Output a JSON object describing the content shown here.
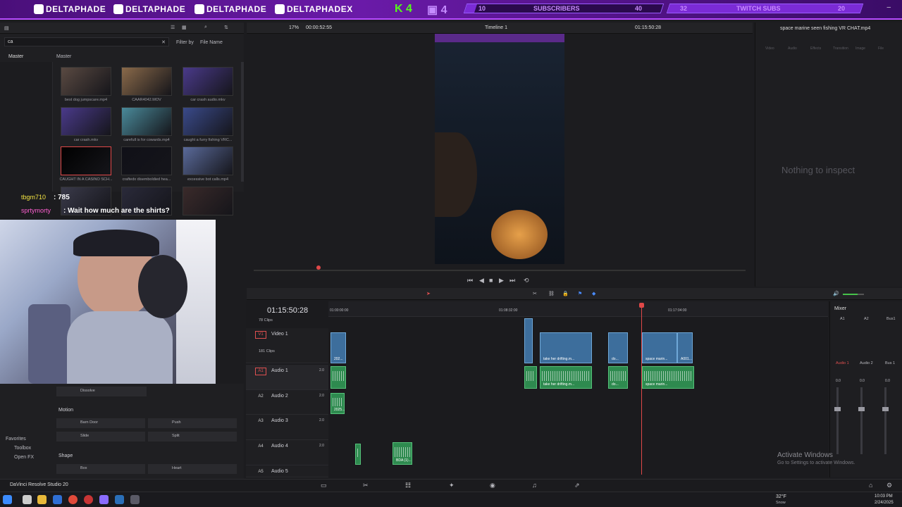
{
  "banner": {
    "socials": [
      "DELTAPHADE",
      "DELTAPHADE",
      "DELTAPHADE",
      "DELTAPHADEX"
    ],
    "kick_label": "K 4",
    "twitch_count": "4",
    "goals": [
      {
        "start": "10",
        "label": "SUBSCRIBERS",
        "end": "40",
        "progress": 0.05
      },
      {
        "start": "32",
        "label": "TWITCH SUBS",
        "end": "20",
        "progress": 1.0
      }
    ]
  },
  "media_pool": {
    "search_value": "ca",
    "filter_label": "Filter by",
    "filter_value": "File Name",
    "bin_label": "Master",
    "bin_header": "Master",
    "clips": [
      "best dog jumpscare.mp4",
      "CAAR4042.MOV",
      "car crash audio.mkv",
      "car crash.mkv",
      "carefull is for cowards.mp4",
      "caught a furry fishing VRC...",
      "CAUGHT IN A CASINO SCH...",
      "craftedx disemboldied hea...",
      "excessive bot calls.mp4",
      "",
      "",
      ""
    ]
  },
  "viewer": {
    "zoom": "17%",
    "source_timecode": "00:00:52:55",
    "timeline_name": "Timeline 1",
    "record_timecode": "01:15:50:28"
  },
  "inspector": {
    "title": "space marine seen fishing VR CHAT.mp4",
    "tabs": [
      "Video",
      "Audio",
      "Effects",
      "Transition",
      "Image",
      "File"
    ],
    "empty_message": "Nothing to inspect"
  },
  "chat": {
    "line1_user": "tbgm710",
    "line1_text": ": 785",
    "line2_user": "sprtymorty",
    "line2_text": ": Wait how much are the shirts?"
  },
  "effects": {
    "items": [
      "Dissolve",
      "Motion",
      "Barn Door",
      "Push",
      "Slide",
      "Split",
      "Shape",
      "Box",
      "Heart"
    ],
    "sidebar": [
      "Favorites",
      "Toolbox",
      "Open FX"
    ]
  },
  "timeline": {
    "timecode": "01:15:50:28",
    "ruler_marks": [
      "01:00:00:00",
      "01:08:32:00",
      "01:17:04:00"
    ],
    "top_clip_count": "78 Clips",
    "tracks": [
      {
        "badge": "V1",
        "name": "Video 1",
        "clips": "181 Clips"
      },
      {
        "badge": "A1",
        "name": "Audio 1",
        "level": "2.0"
      },
      {
        "badge": "A2",
        "name": "Audio 2",
        "level": "2.0"
      },
      {
        "badge": "A3",
        "name": "Audio 3",
        "level": "2.0"
      },
      {
        "badge": "A4",
        "name": "Audio 4",
        "level": "2.0"
      },
      {
        "badge": "A5",
        "name": "Audio 5",
        "level": ""
      }
    ],
    "clip_labels": [
      "202...",
      "take her drifting.m...",
      "do...",
      "space marin...",
      "A001...",
      "2025...",
      "BDA (1)..."
    ]
  },
  "mixer": {
    "title": "Mixer",
    "channels": [
      "A1",
      "A2",
      "Bus1"
    ],
    "strip_labels": [
      "Audio 1",
      "Audio 2",
      "Bus 1"
    ],
    "values": [
      "0.0",
      "0.0",
      "0.0"
    ]
  },
  "app": {
    "name": "DaVinci Resolve Studio 20"
  },
  "watermark": {
    "line1": "Activate Windows",
    "line2": "Go to Settings to activate Windows."
  },
  "system": {
    "weather_temp": "32°F",
    "weather_desc": "Snow",
    "time": "10:03 PM",
    "date": "2/24/2025"
  }
}
